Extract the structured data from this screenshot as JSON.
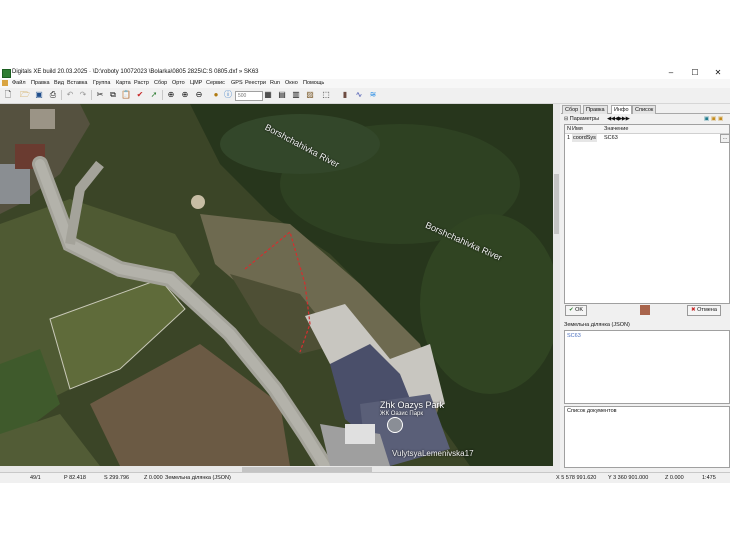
{
  "window": {
    "title": "Digitals XE build 20.03.2025 · \\D:\\roboty 10072023 \\Bolarka\\0805 2825\\C:S 0805.dxf » SK63",
    "controls": [
      "–",
      "☐",
      "✕"
    ]
  },
  "menu": [
    "Файл",
    "Правка",
    "Вид",
    "Вставка",
    "Группа",
    "Карта",
    "Растр",
    "Сбор",
    "Орто",
    "ЦМР",
    "Сервис",
    "GPS",
    "Реестри",
    "Run",
    "Окно",
    "Помощь"
  ],
  "toolbar": {
    "scale_input": "500"
  },
  "map": {
    "labels": [
      {
        "id": "river1",
        "text": "Borshchahivka River"
      },
      {
        "id": "river2",
        "text": "Borshchahivka River"
      },
      {
        "id": "street",
        "text": "VulytsyaLemenivska17"
      }
    ],
    "poi": {
      "name": "Zhk Oazys Park",
      "subname": "ЖК Оазис Парк"
    }
  },
  "panel": {
    "tabs": [
      "Сбор",
      "Правка",
      "Инфо",
      "Список"
    ],
    "active_tab": "Инфо",
    "params_label": "Параметры",
    "grid_headers": {
      "n": "N",
      "name": "Имя",
      "value": "Значение"
    },
    "grid_rows": [
      {
        "n": "1",
        "name": "coordSys",
        "value": "SC63"
      }
    ],
    "ok_label": "OK",
    "cancel_label": "Отмена",
    "json_section_label": "Земельна ділянка (JSON)",
    "json_value": "SC63",
    "docs_section_label": "Список документов"
  },
  "status": {
    "index": "49/1",
    "perimeter": "P 82.418",
    "area": "S 299.796",
    "z": "Z 0.000",
    "layer": "Земельна ділянка (JSON)",
    "x": "X 5 578 991.620",
    "y": "Y 3 360 901.000",
    "z2": "Z 0.000",
    "scale": "1:475"
  },
  "colors": {
    "ok_icon": "#2e7d32",
    "cancel_icon": "#c62828",
    "parcel_line": "#d32f2f"
  }
}
